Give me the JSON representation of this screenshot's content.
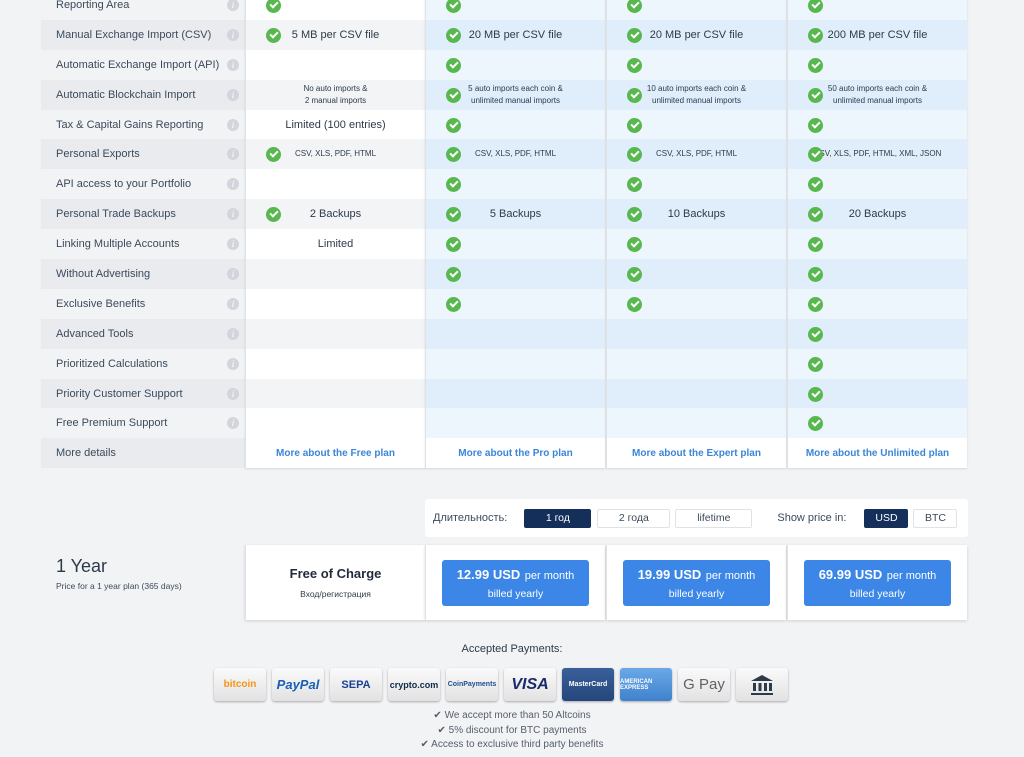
{
  "features": [
    "Reporting Area",
    "Manual Exchange Import (CSV)",
    "Automatic Exchange Import (API)",
    "Automatic Blockchain Import",
    "Tax & Capital Gains Reporting",
    "Personal Exports",
    "API access to your Portfolio",
    "Personal Trade Backups",
    "Linking Multiple Accounts",
    "Without Advertising",
    "Exclusive Benefits",
    "Advanced Tools",
    "Prioritized Calculations",
    "Priority Customer Support",
    "Free Premium Support",
    "More details"
  ],
  "info_icon": "i",
  "plans": {
    "free": {
      "cells": [
        {
          "check": true,
          "text": ""
        },
        {
          "check": true,
          "text": "5 MB per CSV file"
        },
        {
          "check": false,
          "text": ""
        },
        {
          "check": false,
          "text": "No auto imports &\n2 manual imports",
          "small": true
        },
        {
          "check": false,
          "text": "Limited (100 entries)"
        },
        {
          "check": true,
          "text": "CSV, XLS, PDF, HTML",
          "small": true
        },
        {
          "check": false,
          "text": ""
        },
        {
          "check": true,
          "text": "2 Backups"
        },
        {
          "check": false,
          "text": "Limited"
        },
        {
          "check": false,
          "text": ""
        },
        {
          "check": false,
          "text": ""
        },
        {
          "check": false,
          "text": ""
        },
        {
          "check": false,
          "text": ""
        },
        {
          "check": false,
          "text": ""
        },
        {
          "check": false,
          "text": ""
        }
      ],
      "more": "More about the Free plan"
    },
    "pro": {
      "cells": [
        {
          "check": true,
          "text": ""
        },
        {
          "check": true,
          "text": "20 MB per CSV file"
        },
        {
          "check": true,
          "text": ""
        },
        {
          "check": true,
          "text": "5 auto imports each coin &\nunlimited manual imports",
          "small": true
        },
        {
          "check": true,
          "text": ""
        },
        {
          "check": true,
          "text": "CSV, XLS, PDF, HTML",
          "small": true
        },
        {
          "check": true,
          "text": ""
        },
        {
          "check": true,
          "text": "5 Backups"
        },
        {
          "check": true,
          "text": ""
        },
        {
          "check": true,
          "text": ""
        },
        {
          "check": true,
          "text": ""
        },
        {
          "check": false,
          "text": ""
        },
        {
          "check": false,
          "text": ""
        },
        {
          "check": false,
          "text": ""
        },
        {
          "check": false,
          "text": ""
        }
      ],
      "more": "More about the Pro plan"
    },
    "expert": {
      "cells": [
        {
          "check": true,
          "text": ""
        },
        {
          "check": true,
          "text": "20 MB per CSV file"
        },
        {
          "check": true,
          "text": ""
        },
        {
          "check": true,
          "text": "10 auto imports each coin &\nunlimited manual imports",
          "small": true
        },
        {
          "check": true,
          "text": ""
        },
        {
          "check": true,
          "text": "CSV, XLS, PDF, HTML",
          "small": true
        },
        {
          "check": true,
          "text": ""
        },
        {
          "check": true,
          "text": "10 Backups"
        },
        {
          "check": true,
          "text": ""
        },
        {
          "check": true,
          "text": ""
        },
        {
          "check": true,
          "text": ""
        },
        {
          "check": false,
          "text": ""
        },
        {
          "check": false,
          "text": ""
        },
        {
          "check": false,
          "text": ""
        },
        {
          "check": false,
          "text": ""
        }
      ],
      "more": "More about the Expert plan"
    },
    "unlimited": {
      "cells": [
        {
          "check": true,
          "text": ""
        },
        {
          "check": true,
          "text": "200 MB per CSV file"
        },
        {
          "check": true,
          "text": ""
        },
        {
          "check": true,
          "text": "50 auto imports each coin &\nunlimited manual imports",
          "small": true
        },
        {
          "check": true,
          "text": ""
        },
        {
          "check": true,
          "text": "CSV, XLS, PDF, HTML, XML, JSON",
          "small": true
        },
        {
          "check": true,
          "text": ""
        },
        {
          "check": true,
          "text": "20 Backups"
        },
        {
          "check": true,
          "text": ""
        },
        {
          "check": true,
          "text": ""
        },
        {
          "check": true,
          "text": ""
        },
        {
          "check": true,
          "text": ""
        },
        {
          "check": true,
          "text": ""
        },
        {
          "check": true,
          "text": ""
        },
        {
          "check": true,
          "text": ""
        }
      ],
      "more": "More about the Unlimited plan"
    }
  },
  "controls": {
    "duration_label": "Длительность:",
    "durations": [
      "1 год",
      "2 года",
      "lifetime"
    ],
    "duration_selected": "1 год",
    "currency_label": "Show price in:",
    "currencies": [
      "USD",
      "BTC"
    ],
    "currency_selected": "USD"
  },
  "period": {
    "title": "1 Year",
    "subtitle": "Price for a 1 year plan (365 days)"
  },
  "prices": {
    "free": {
      "title": "Free of Charge",
      "sub": "Вход/регистрация"
    },
    "pro": {
      "amount": "12.99 USD",
      "per": "per month",
      "billing": "billed yearly"
    },
    "expert": {
      "amount": "19.99 USD",
      "per": "per month",
      "billing": "billed yearly"
    },
    "unlimited": {
      "amount": "69.99 USD",
      "per": "per month",
      "billing": "billed yearly"
    }
  },
  "payments": {
    "title": "Accepted Payments:",
    "methods": [
      {
        "name": "bitcoin-logo",
        "label": "bitcoin",
        "color": "#f7931a"
      },
      {
        "name": "paypal-logo",
        "label": "PayPal",
        "color": "#1a5fb4"
      },
      {
        "name": "sepa-paypal-logo",
        "label": "SEPA",
        "color": "#1c3f94"
      },
      {
        "name": "crypto-com-logo",
        "label": "crypto.com",
        "color": "#0f2a4a"
      },
      {
        "name": "coinpayments-logo",
        "label": "CoinPayments",
        "color": "#1b4f91"
      },
      {
        "name": "visa-logo",
        "label": "VISA",
        "color": "#1a2b6d"
      },
      {
        "name": "mastercard-logo",
        "label": "MasterCard",
        "color": "#e8451d"
      },
      {
        "name": "amex-logo",
        "label": "AMERICAN EXPRESS",
        "color": "#4a90d9"
      },
      {
        "name": "google-pay-logo",
        "label": "G Pay",
        "color": "#5f6368"
      },
      {
        "name": "bank-transfer-logo",
        "label": "",
        "color": "#2d3a4a"
      }
    ],
    "notes": [
      "✔ We accept more than 50 Altcoins",
      "✔ 5% discount for BTC payments",
      "✔ Access to exclusive third party benefits"
    ]
  }
}
